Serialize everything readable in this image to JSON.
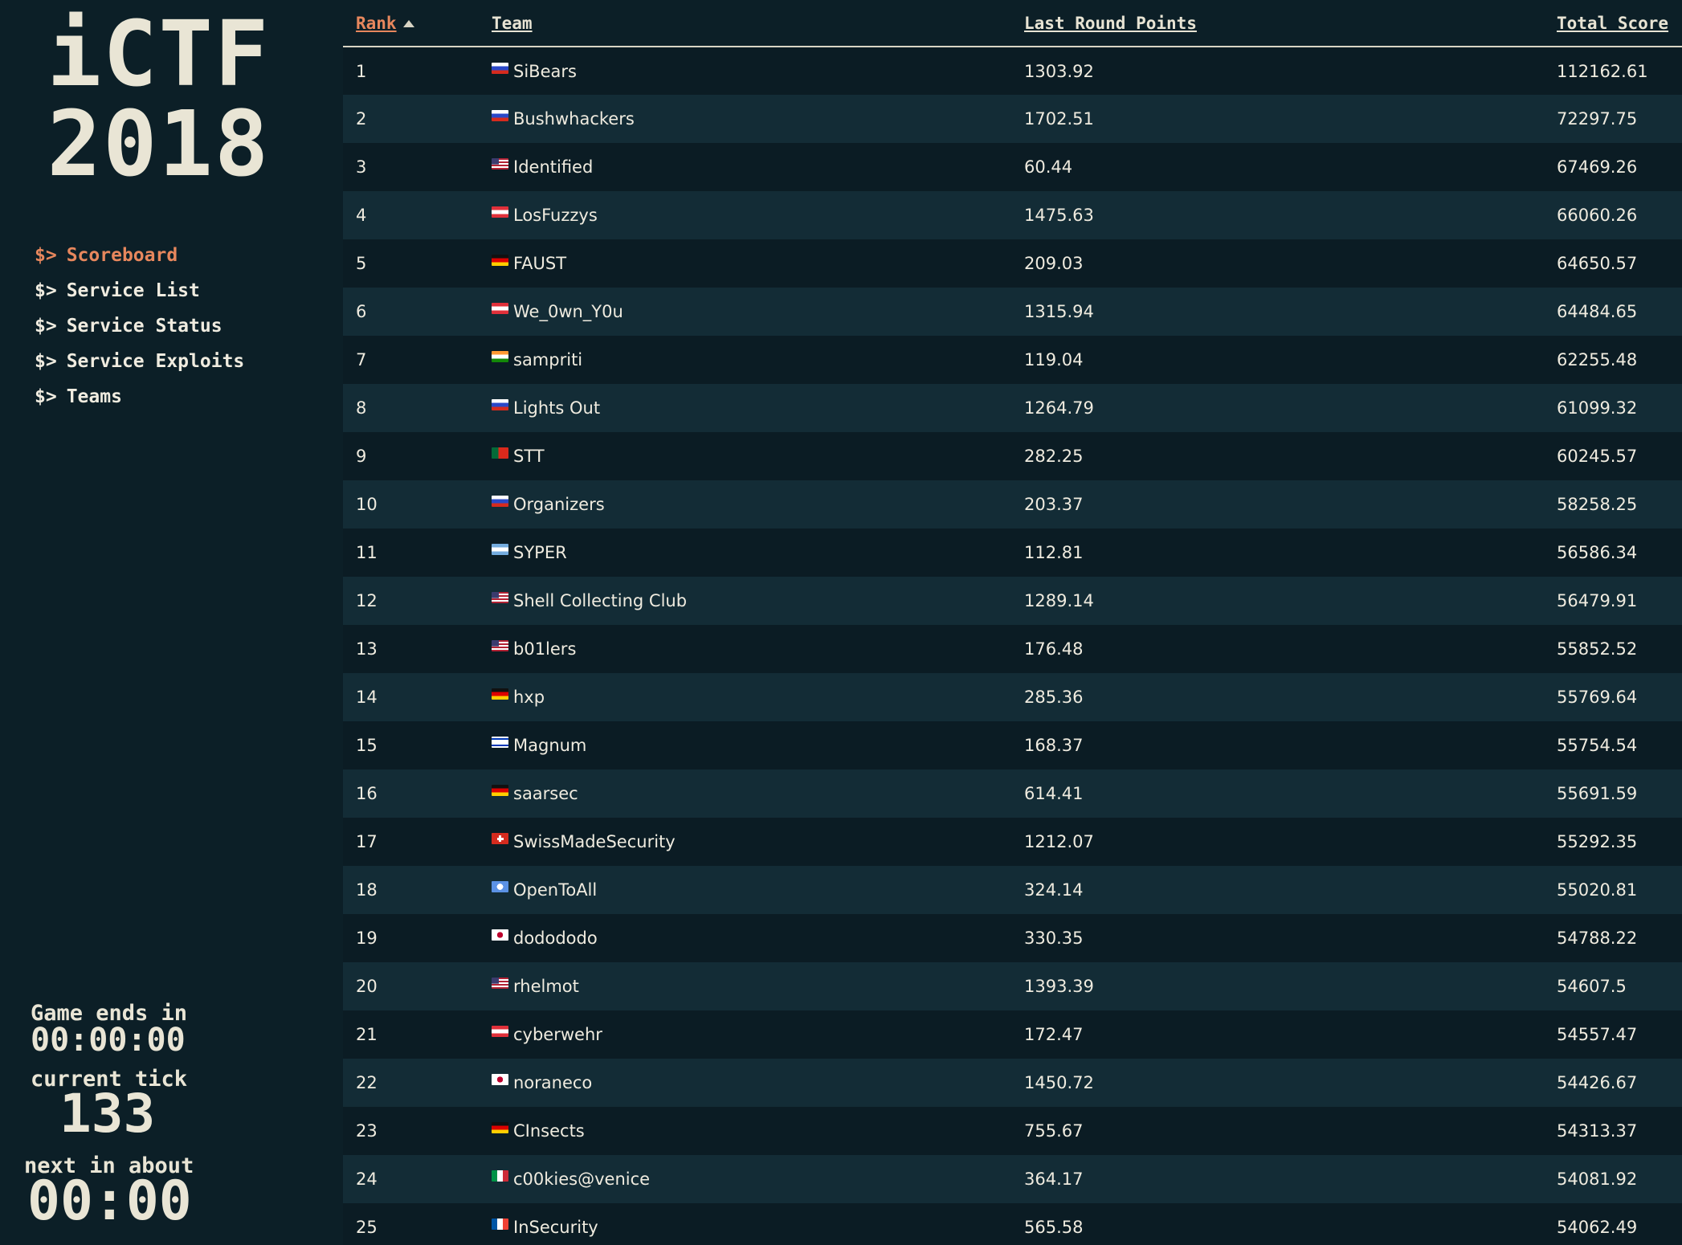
{
  "sidebar": {
    "logo_line1": "iCTF",
    "logo_line2": "2018",
    "nav_prompt": "$>",
    "nav": [
      {
        "label": "Scoreboard",
        "active": true
      },
      {
        "label": "Service List",
        "active": false
      },
      {
        "label": "Service Status",
        "active": false
      },
      {
        "label": "Service Exploits",
        "active": false
      },
      {
        "label": "Teams",
        "active": false
      }
    ],
    "game_ends_label": "Game ends in",
    "game_ends_value": "00:00:00",
    "current_tick_label": "current tick",
    "current_tick_value": "133",
    "next_label": "next in about",
    "next_value": "00:00"
  },
  "colors": {
    "background": "#0c1f27",
    "row_alt": "#132c36",
    "accent": "#e7875d",
    "text": "#e8e4d4"
  },
  "table": {
    "headers": {
      "rank": "Rank",
      "team": "Team",
      "last_round": "Last Round Points",
      "total": "Total Score"
    },
    "sorted_column": "rank",
    "sort_direction": "ascending",
    "rows": [
      {
        "rank": "1",
        "flag": "ru",
        "team": "SiBears",
        "last": "1303.92",
        "total": "112162.61"
      },
      {
        "rank": "2",
        "flag": "ru",
        "team": "Bushwhackers",
        "last": "1702.51",
        "total": "72297.75"
      },
      {
        "rank": "3",
        "flag": "us",
        "team": "Identified",
        "last": "60.44",
        "total": "67469.26"
      },
      {
        "rank": "4",
        "flag": "at",
        "team": "LosFuzzys",
        "last": "1475.63",
        "total": "66060.26"
      },
      {
        "rank": "5",
        "flag": "de",
        "team": "FAUST",
        "last": "209.03",
        "total": "64650.57"
      },
      {
        "rank": "6",
        "flag": "at",
        "team": "We_0wn_Y0u",
        "last": "1315.94",
        "total": "64484.65"
      },
      {
        "rank": "7",
        "flag": "in",
        "team": "sampriti",
        "last": "119.04",
        "total": "62255.48"
      },
      {
        "rank": "8",
        "flag": "ru",
        "team": "Lights Out",
        "last": "1264.79",
        "total": "61099.32"
      },
      {
        "rank": "9",
        "flag": "pt",
        "team": "STT",
        "last": "282.25",
        "total": "60245.57"
      },
      {
        "rank": "10",
        "flag": "ru",
        "team": "Organizers",
        "last": "203.37",
        "total": "58258.25"
      },
      {
        "rank": "11",
        "flag": "ar",
        "team": "SYPER",
        "last": "112.81",
        "total": "56586.34"
      },
      {
        "rank": "12",
        "flag": "us",
        "team": "Shell Collecting Club",
        "last": "1289.14",
        "total": "56479.91"
      },
      {
        "rank": "13",
        "flag": "us",
        "team": "b01lers",
        "last": "176.48",
        "total": "55852.52"
      },
      {
        "rank": "14",
        "flag": "de",
        "team": "hxp",
        "last": "285.36",
        "total": "55769.64"
      },
      {
        "rank": "15",
        "flag": "il",
        "team": "Magnum",
        "last": "168.37",
        "total": "55754.54"
      },
      {
        "rank": "16",
        "flag": "de",
        "team": "saarsec",
        "last": "614.41",
        "total": "55691.59"
      },
      {
        "rank": "17",
        "flag": "ch",
        "team": "SwissMadeSecurity",
        "last": "1212.07",
        "total": "55292.35"
      },
      {
        "rank": "18",
        "flag": "un",
        "team": "OpenToAll",
        "last": "324.14",
        "total": "55020.81"
      },
      {
        "rank": "19",
        "flag": "jp",
        "team": "dodododo",
        "last": "330.35",
        "total": "54788.22"
      },
      {
        "rank": "20",
        "flag": "us",
        "team": "rhelmot",
        "last": "1393.39",
        "total": "54607.5"
      },
      {
        "rank": "21",
        "flag": "at",
        "team": "cyberwehr",
        "last": "172.47",
        "total": "54557.47"
      },
      {
        "rank": "22",
        "flag": "jp",
        "team": "noraneco",
        "last": "1450.72",
        "total": "54426.67"
      },
      {
        "rank": "23",
        "flag": "de",
        "team": "CInsects",
        "last": "755.67",
        "total": "54313.37"
      },
      {
        "rank": "24",
        "flag": "it",
        "team": "c00kies@venice",
        "last": "364.17",
        "total": "54081.92"
      },
      {
        "rank": "25",
        "flag": "fr",
        "team": "InSecurity",
        "last": "565.58",
        "total": "54062.49"
      }
    ]
  }
}
